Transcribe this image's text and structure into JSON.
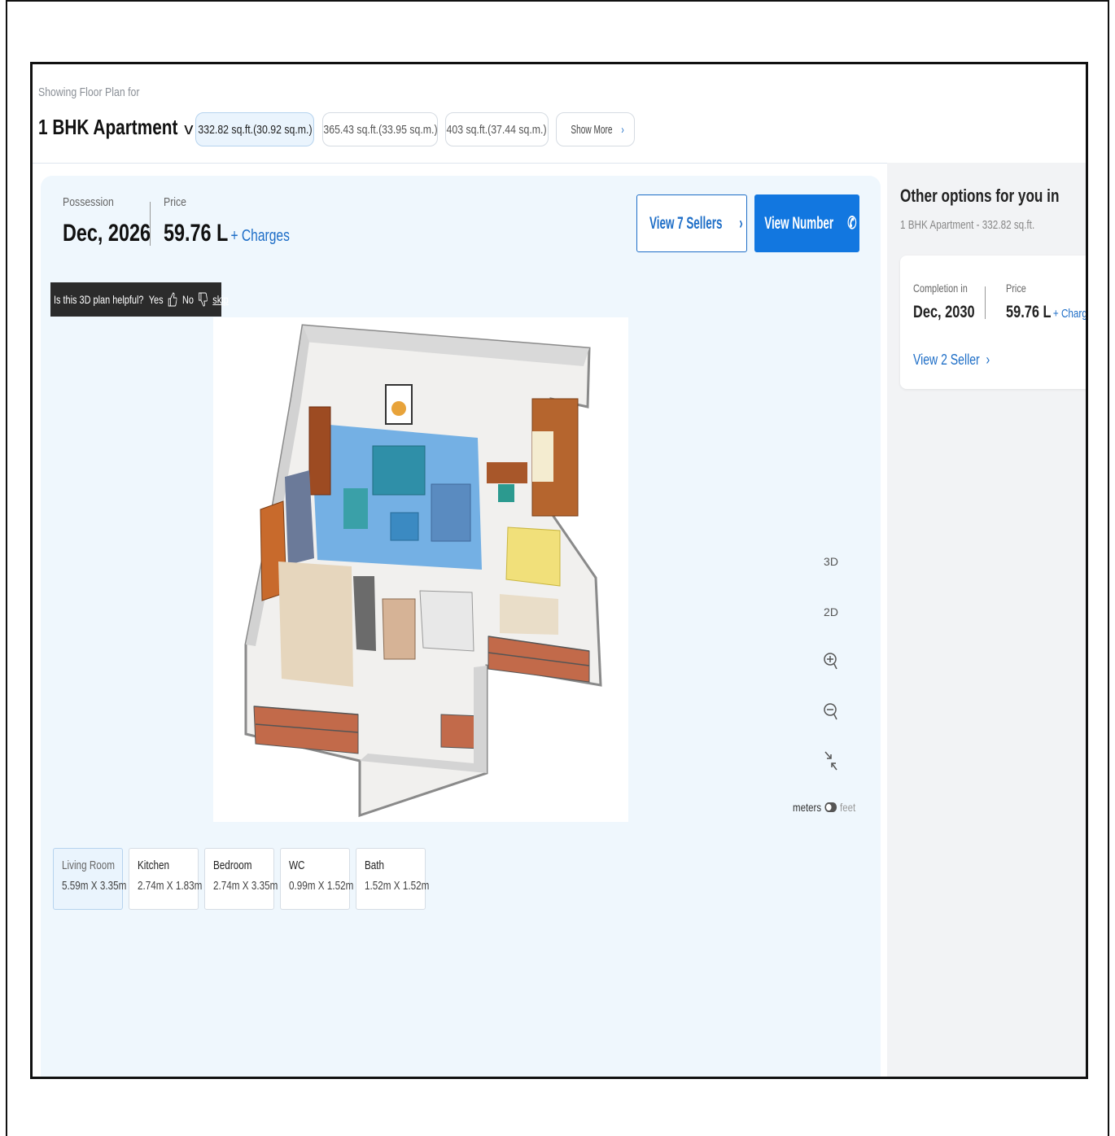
{
  "header": {
    "showing_label": "Showing Floor Plan for",
    "unit_type": "1 BHK Apartment",
    "area_options": [
      "332.82 sq.ft.(30.92 sq.m.)",
      "365.43 sq.ft.(33.95 sq.m.)",
      "403 sq.ft.(37.44 sq.m.)"
    ],
    "show_more": "Show More"
  },
  "summary": {
    "possession_label": "Possession",
    "possession_value": "Dec, 2026",
    "price_label": "Price",
    "price_value": "59.76 L",
    "charges_link": "+ Charges"
  },
  "actions": {
    "view_sellers": "View 7 Sellers",
    "view_number": "View Number"
  },
  "feedback": {
    "question": "Is this 3D plan helpful?",
    "yes": "Yes",
    "no": "No",
    "skip": "skip"
  },
  "plan_controls": {
    "view_3d": "3D",
    "view_2d": "2D",
    "unit_meters": "meters",
    "unit_feet": "feet"
  },
  "rooms": [
    {
      "name": "Living Room",
      "dims": "5.59m X 3.35m"
    },
    {
      "name": "Kitchen",
      "dims": "2.74m X 1.83m"
    },
    {
      "name": "Bedroom",
      "dims": "2.74m X 3.35m"
    },
    {
      "name": "WC",
      "dims": "0.99m X 1.52m"
    },
    {
      "name": "Bath",
      "dims": "1.52m X 1.52m"
    }
  ],
  "sidebar": {
    "title": "Other options for you in",
    "subtitle": "1 BHK Apartment - 332.82 sq.ft.",
    "card": {
      "completion_label": "Completion in",
      "completion_value": "Dec, 2030",
      "price_label": "Price",
      "price_value": "59.76 L",
      "charges_link": "+ Charges",
      "sellers_link": "View 2 Seller"
    }
  },
  "colors": {
    "accent": "#1277e0",
    "link": "#1e6ec7",
    "panel_bg": "#eff7fd",
    "sidebar_bg": "#f2f3f5",
    "living_room_highlight": "#4a9be0"
  },
  "icons": [
    "chevron-down-icon",
    "chevron-right-icon",
    "phone-icon",
    "thumbs-up-icon",
    "thumbs-down-icon",
    "zoom-in-icon",
    "zoom-out-icon",
    "collapse-icon",
    "toggle-switch-icon"
  ]
}
